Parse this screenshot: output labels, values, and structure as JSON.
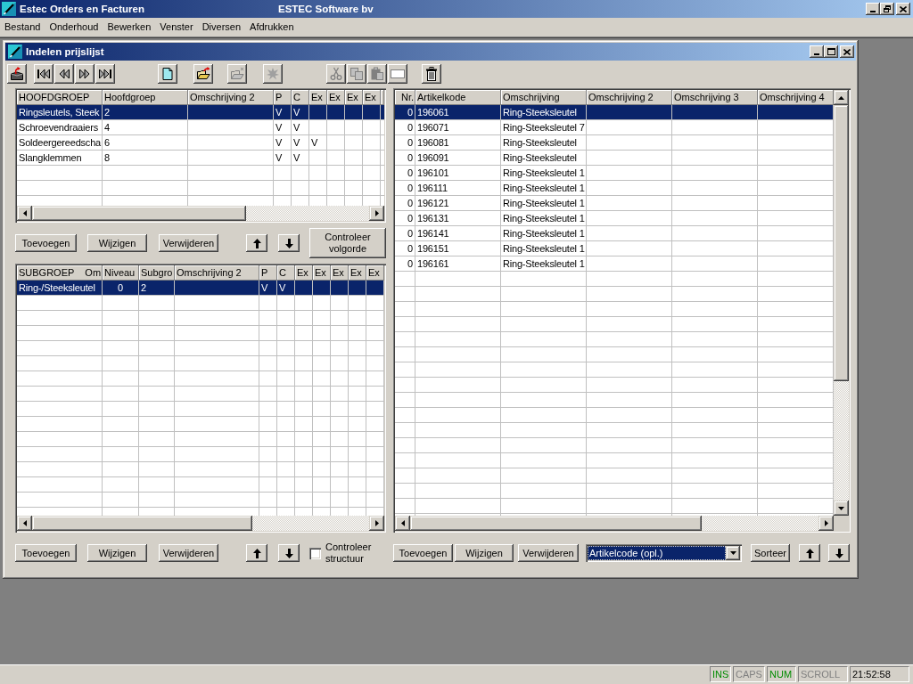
{
  "window": {
    "title": "Estec Orders en Facturen",
    "company": "ESTEC Software bv"
  },
  "menu": [
    "Bestand",
    "Onderhoud",
    "Bewerken",
    "Venster",
    "Diversen",
    "Afdrukken"
  ],
  "child_window": {
    "title": "Indelen prijslijst",
    "toolbar": [
      [
        {
          "kind": "exit",
          "disabled": false
        }
      ],
      [
        {
          "kind": "first",
          "disabled": false
        },
        {
          "kind": "previous",
          "disabled": false
        },
        {
          "kind": "next",
          "disabled": false
        },
        {
          "kind": "last",
          "disabled": false
        }
      ],
      [
        {
          "kind": "new",
          "disabled": false
        }
      ],
      [
        {
          "kind": "open",
          "disabled": false
        }
      ],
      [
        {
          "kind": "folder",
          "disabled": true
        }
      ],
      [
        {
          "kind": "burst",
          "disabled": true
        }
      ],
      [
        {
          "kind": "cut",
          "disabled": true
        },
        {
          "kind": "copy",
          "disabled": true
        },
        {
          "kind": "paste",
          "disabled": true
        },
        {
          "kind": "blank",
          "disabled": true
        }
      ],
      [
        {
          "kind": "delete",
          "disabled": false
        }
      ]
    ]
  },
  "hoofdgroepen": {
    "columns": [
      "HOOFDGROEP",
      "Hoofdgroep",
      "Omschrijving 2",
      "P",
      "C",
      "Ex",
      "Ex",
      "Ex",
      "Ex"
    ],
    "rows": [
      {
        "cells": [
          "Ringsleutels, Steek",
          "2",
          null,
          "V",
          "V"
        ],
        "selected": true
      },
      {
        "cells": [
          "Schroevendraaiers",
          "4",
          null,
          "V",
          "V"
        ],
        "selected": false
      },
      {
        "cells": [
          "Soldeergereedscha",
          "6",
          null,
          "V",
          "V",
          "V"
        ],
        "selected": false
      },
      {
        "cells": [
          "Slangklemmen",
          "8",
          null,
          "V",
          "V"
        ],
        "selected": false
      }
    ],
    "buttons": [
      "Toevoegen",
      "Wijzigen",
      "Verwijderen"
    ],
    "check_button": "Controleer volgorde"
  },
  "subgroepen": {
    "columns": [
      "SUBGROEP    Om",
      "Niveau",
      "Subgro",
      "Omschrijving 2",
      "P",
      "C",
      "Ex",
      "Ex",
      "Ex",
      "Ex",
      "Ex"
    ],
    "rows": [
      {
        "cells": [
          "Ring-/Steeksleutel",
          "0",
          "2",
          null,
          "V",
          "V"
        ],
        "selected": true
      }
    ],
    "buttons": [
      "Toevoegen",
      "Wijzigen",
      "Verwijderen"
    ],
    "check": {
      "label": "Controleer structuur",
      "checked": false
    }
  },
  "artikelen": {
    "columns": [
      "Nr.",
      "Artikelkode",
      "Omschrijving",
      "Omschrijving 2",
      "Omschrijving 3",
      "Omschrijving 4"
    ],
    "rows": [
      {
        "cells": [
          "0",
          "196061",
          "Ring-Steeksleutel"
        ],
        "selected": true
      },
      {
        "cells": [
          "0",
          "196071",
          "Ring-Steeksleutel 7"
        ],
        "selected": false
      },
      {
        "cells": [
          "0",
          "196081",
          "Ring-Steeksleutel"
        ],
        "selected": false
      },
      {
        "cells": [
          "0",
          "196091",
          "Ring-Steeksleutel"
        ],
        "selected": false
      },
      {
        "cells": [
          "0",
          "196101",
          "Ring-Steeksleutel 1"
        ],
        "selected": false
      },
      {
        "cells": [
          "0",
          "196111",
          "Ring-Steeksleutel 1"
        ],
        "selected": false
      },
      {
        "cells": [
          "0",
          "196121",
          "Ring-Steeksleutel 1"
        ],
        "selected": false
      },
      {
        "cells": [
          "0",
          "196131",
          "Ring-Steeksleutel 1"
        ],
        "selected": false
      },
      {
        "cells": [
          "0",
          "196141",
          "Ring-Steeksleutel 1"
        ],
        "selected": false
      },
      {
        "cells": [
          "0",
          "196151",
          "Ring-Steeksleutel 1"
        ],
        "selected": false
      },
      {
        "cells": [
          "0",
          "196161",
          "Ring-Steeksleutel 1"
        ],
        "selected": false
      }
    ],
    "buttons": [
      "Toevoegen",
      "Wijzigen",
      "Verwijderen"
    ],
    "sort_field": {
      "value": "Artikelcode (opl.)",
      "focused": true
    },
    "sort_button": "Sorteer"
  },
  "status_bar": {
    "indicators": [
      {
        "label": "INS",
        "on": true
      },
      {
        "label": "CAPS",
        "on": false
      },
      {
        "label": "NUM",
        "on": true
      },
      {
        "label": "SCROLL",
        "on": false
      }
    ],
    "time": "21:52:58"
  }
}
